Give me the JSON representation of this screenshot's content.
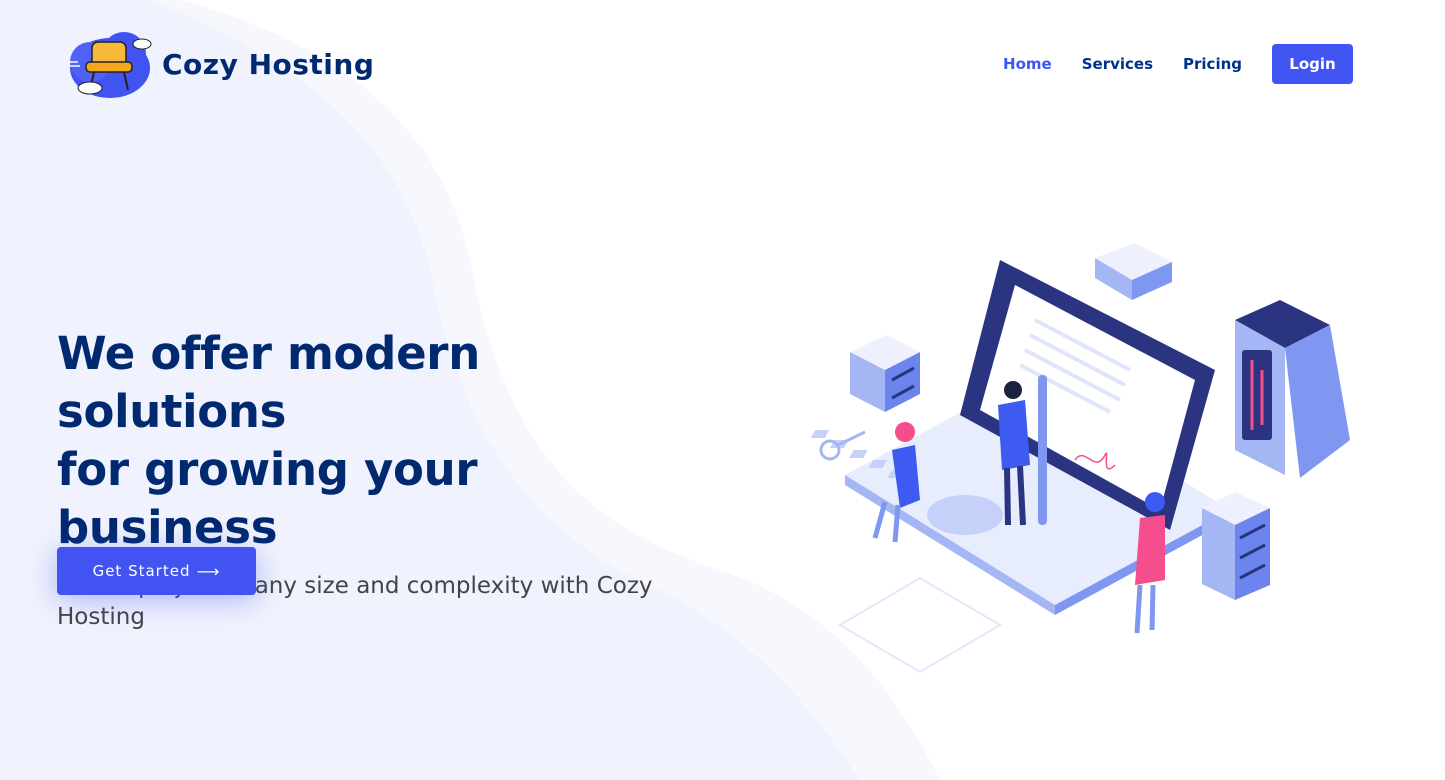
{
  "brand": {
    "name": "Cozy Hosting",
    "logo_icon": "cloud-armchair-logo"
  },
  "nav": {
    "items": [
      {
        "label": "Home",
        "active": true
      },
      {
        "label": "Services",
        "active": false
      },
      {
        "label": "Pricing",
        "active": false
      }
    ],
    "login_label": "Login"
  },
  "hero": {
    "title_line1": "We offer modern solutions",
    "title_line2": "for growing your business",
    "subtitle": "Host a project of any size and complexity with Cozy Hosting",
    "cta_label": "Get Started",
    "cta_icon": "arrow-right-icon"
  },
  "colors": {
    "primary": "#4154f1",
    "heading": "#012970",
    "nav_text": "#013289",
    "body_text": "#444444",
    "wave_bg": "#f0f3fd"
  }
}
